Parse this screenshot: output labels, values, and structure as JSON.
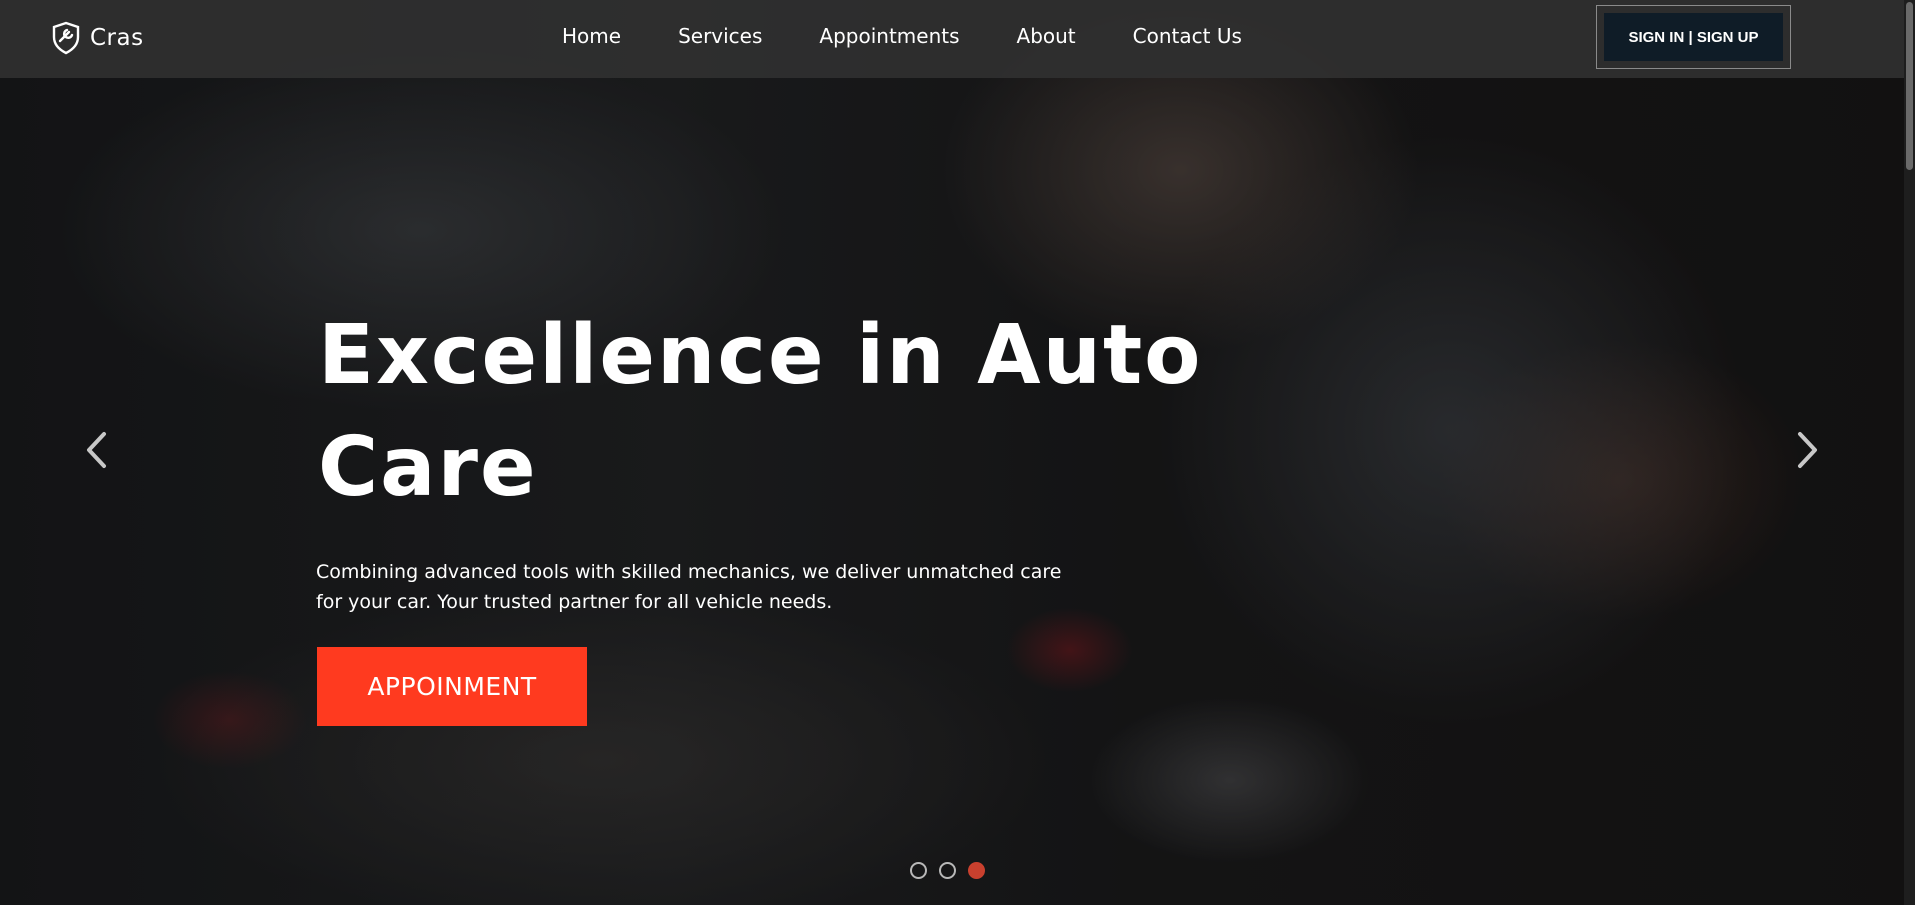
{
  "brand": {
    "name": "Cras",
    "logo_icon": "shield-wrench-icon"
  },
  "nav": {
    "links": [
      {
        "label": "Home"
      },
      {
        "label": "Services"
      },
      {
        "label": "Appointments"
      },
      {
        "label": "About"
      },
      {
        "label": "Contact Us"
      }
    ],
    "auth_label": "SIGN IN | SIGN UP"
  },
  "hero": {
    "headline": "Excellence in Auto Care",
    "subtext": "Combining advanced tools with skilled mechanics, we deliver unmatched care for your car. Your trusted partner for all vehicle needs.",
    "cta_label": "APPOINMENT",
    "prev_icon": "chevron-left-icon",
    "next_icon": "chevron-right-icon"
  },
  "carousel": {
    "slide_count": 3,
    "active_index": 2
  },
  "colors": {
    "accent": "#ff3a1f",
    "auth_button_bg": "#0f1c27",
    "active_dot": "#c9402e"
  }
}
